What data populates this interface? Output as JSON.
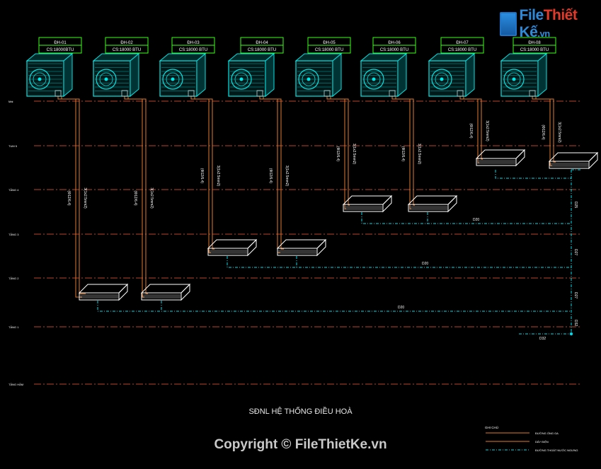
{
  "brand": {
    "name_main": "File",
    "name_accent": "Thiết",
    "name_end": "Kế",
    "domain": ".vn"
  },
  "units": [
    {
      "code": "ĐH-01",
      "capacity": "CS:18000BTU",
      "pipe_label_a": "(Φ12/6.4)",
      "pipe_label_b": "3(1x2.5mm2)"
    },
    {
      "code": "ĐH-02",
      "capacity": "CS:18000 BTU",
      "pipe_label_a": "(Φ12/6.4)",
      "pipe_label_b": "3(1x2.5mm2)"
    },
    {
      "code": "ĐH-03",
      "capacity": "CS:18000 BTU",
      "pipe_label_a": "(Φ12/6.4)",
      "pipe_label_b": "3(1x2.5mm2)"
    },
    {
      "code": "ĐH-04",
      "capacity": "CS:18000 BTU",
      "pipe_label_a": "(Φ12/6.4)",
      "pipe_label_b": "3(1x2.5mm2)"
    },
    {
      "code": "ĐH-05",
      "capacity": "CS:18000 BTU",
      "pipe_label_a": "(Φ12/6.4)",
      "pipe_label_b": "3(1x2.5mm2)"
    },
    {
      "code": "ĐH-06",
      "capacity": "CS:18000 BTU",
      "pipe_label_a": "(Φ12/6.4)",
      "pipe_label_b": "3(1x2.5mm2)"
    },
    {
      "code": "ĐH-07",
      "capacity": "CS:18000 BTU",
      "pipe_label_a": "(Φ12/6.4)",
      "pipe_label_b": "3(1x2.5mm2)"
    },
    {
      "code": "ĐH-08",
      "capacity": "CS:18000 BTU",
      "pipe_label_a": "(Φ12/6.4)",
      "pipe_label_b": "3(1x2.5mm2)"
    }
  ],
  "floors": [
    "Mái",
    "TUM 5",
    "TẦNG 4",
    "TẦNG 3",
    "TẦNG 2",
    "TẦNG 1",
    "TẦNG HẦM"
  ],
  "drain_labels": {
    "d20": "D20",
    "d25": "D25",
    "d27": "D27",
    "d32": "D32"
  },
  "title": "SĐNL HỆ THỐNG ĐIỀU HOÀ",
  "legend": {
    "title": "GHI CHÚ",
    "items": [
      "ĐƯỜNG ỐNG GA",
      "DÂY ĐIỆN",
      "ĐƯỜNG THOÁT NƯỚC NGƯNG"
    ]
  },
  "copyright": "Copyright © FileThietKe.vn",
  "colors": {
    "floor_line": "#b8452b",
    "pipe": "#e07a2e",
    "unit": "#00e6e6",
    "label_box": "#39ff14",
    "drain": "#00d8e8",
    "text": "#ffffff"
  }
}
